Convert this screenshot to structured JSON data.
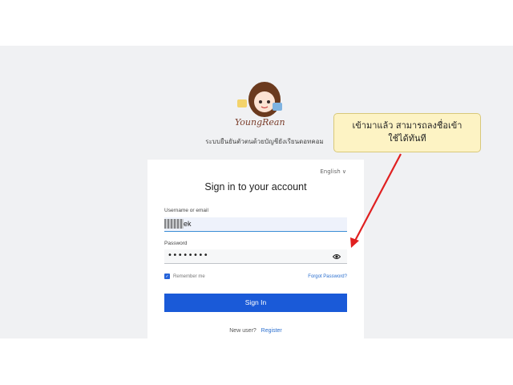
{
  "brand": {
    "logo_text": "YoungRean"
  },
  "tagline": "ระบบยืนยันตัวตนด้วยบัญชียังเรียนดอทคอม",
  "login": {
    "language": "English ∨",
    "title": "Sign in to your account",
    "username_label": "Username or email",
    "username_value": "ek",
    "password_label": "Password",
    "password_value": "••••••••",
    "remember_label": "Remember me",
    "remember_checked": true,
    "forgot_label": "Forgot Password?",
    "signin_label": "Sign In",
    "new_user_text": "New user?",
    "register_label": "Register"
  },
  "annotation": {
    "line1": "เข้ามาแล้ว สามารถลงชื่อเข้า",
    "line2": "ใช้ได้ทันที",
    "arrow_color": "#e02020"
  },
  "colors": {
    "primary": "#1a5ad8",
    "link": "#2b6fcf",
    "callout_bg": "#fdf3c4"
  }
}
